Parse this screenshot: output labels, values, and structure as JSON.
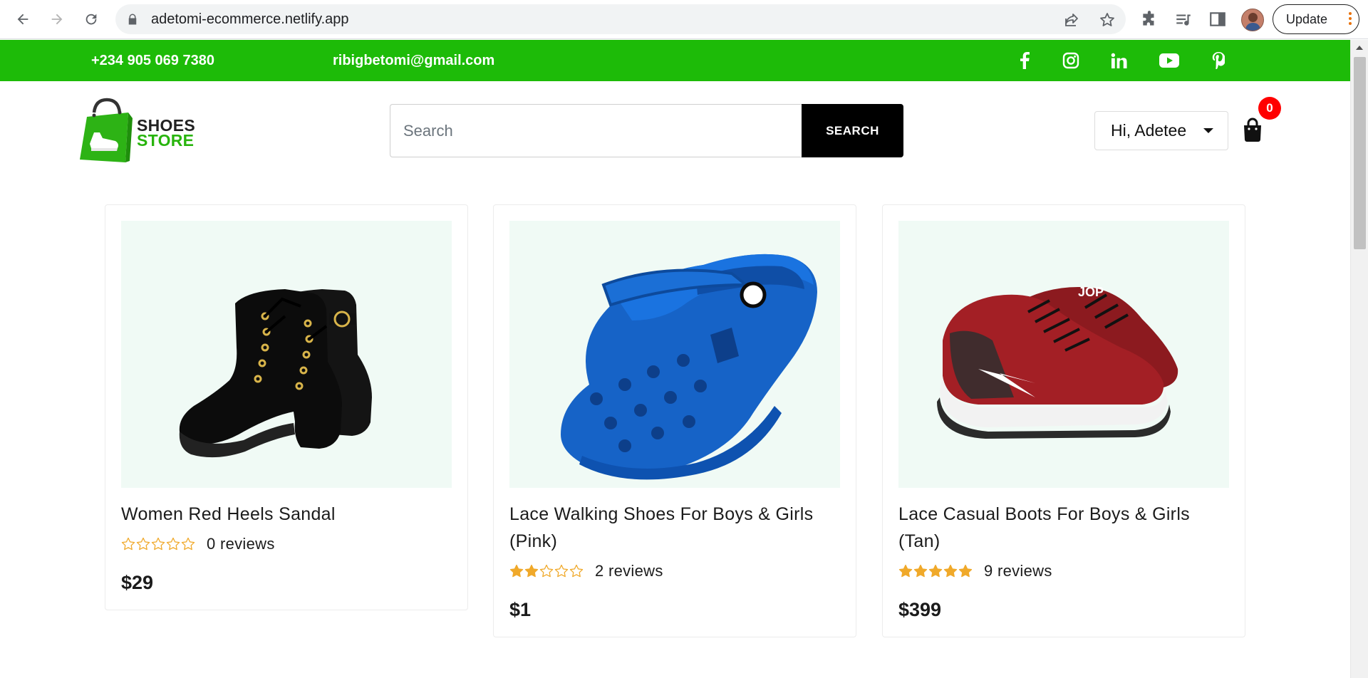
{
  "browser": {
    "url": "adetomi-ecommerce.netlify.app",
    "update_label": "Update"
  },
  "topbar": {
    "phone": "+234 905 069 7380",
    "email": "ribigbetomi@gmail.com",
    "socials": [
      "facebook-icon",
      "instagram-icon",
      "linkedin-icon",
      "youtube-icon",
      "pinterest-icon"
    ],
    "background": "#1dbb08"
  },
  "header": {
    "logo": {
      "line1": "SHOES",
      "line2": "STORE"
    },
    "search": {
      "placeholder": "Search",
      "button_label": "SEARCH"
    },
    "user_menu": {
      "label": "Hi, Adetee"
    },
    "cart": {
      "count": "0"
    }
  },
  "products": [
    {
      "name": "Women Red Heels Sandal",
      "rating": 0,
      "reviews": "0 reviews",
      "price": "$29",
      "image": "black-ankle-boot"
    },
    {
      "name": "Lace Walking Shoes For Boys & Girls (Pink)",
      "rating": 2,
      "reviews": "2 reviews",
      "price": "$1",
      "image": "blue-clog"
    },
    {
      "name": "Lace Casual Boots For Boys & Girls (Tan)",
      "rating": 5,
      "reviews": "9 reviews",
      "price": "$399",
      "image": "red-sneaker"
    }
  ],
  "colors": {
    "star": "#f0a92a",
    "accent": "#1dbb08",
    "badge": "#ff0000"
  }
}
